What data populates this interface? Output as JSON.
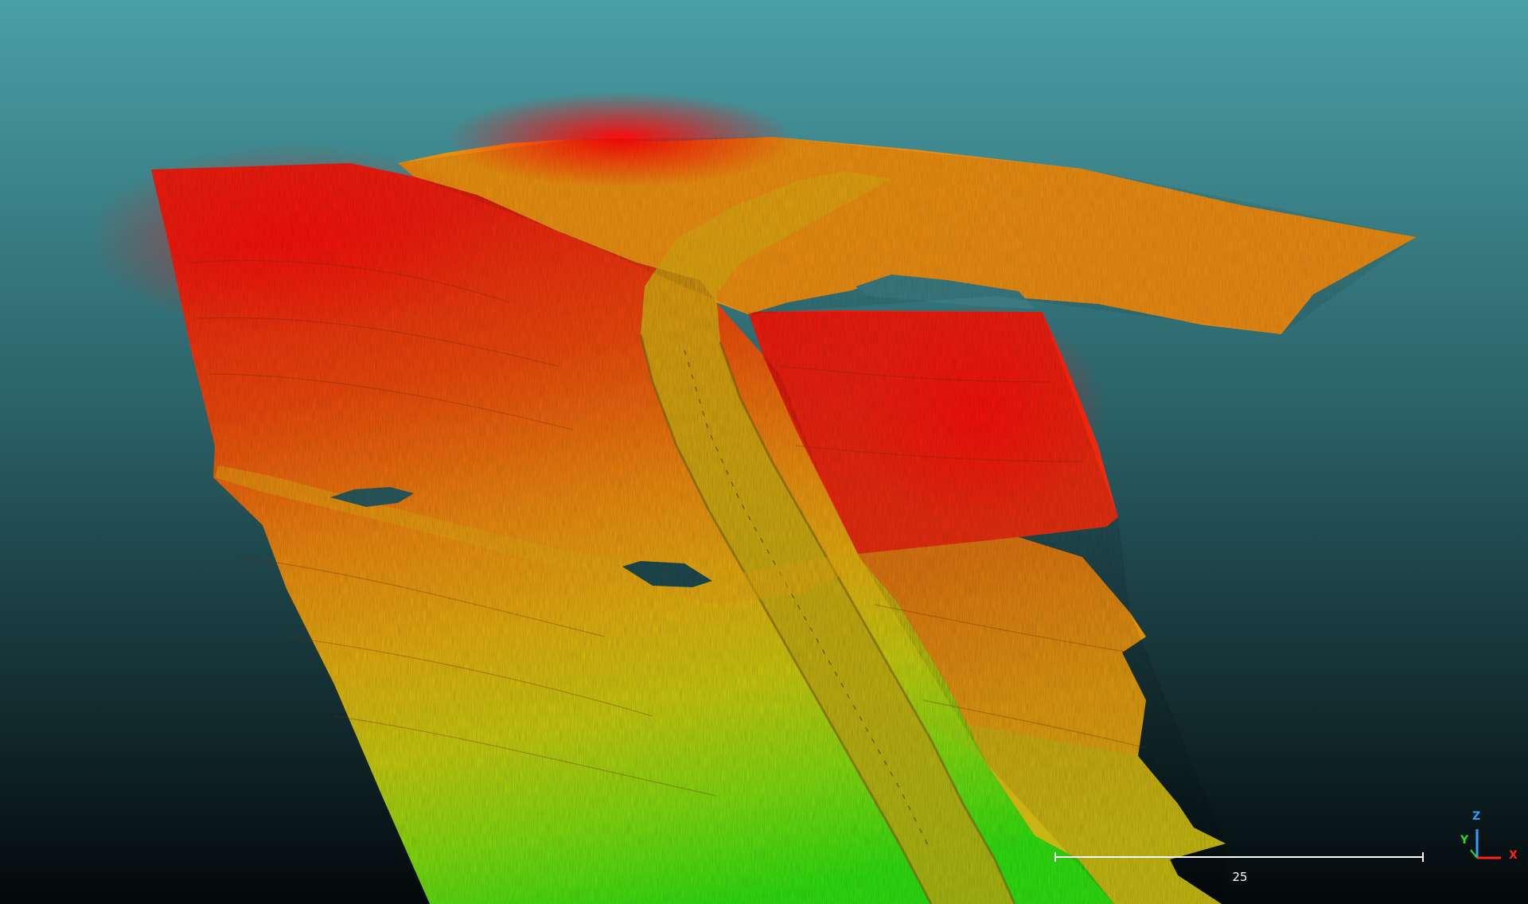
{
  "viewer": {
    "background_top": "#4a9fa6",
    "background_bottom": "#050a0c",
    "colormap": [
      "#ff0000",
      "#ff7a00",
      "#e0a800",
      "#b8d800",
      "#30e000"
    ]
  },
  "scale_bar": {
    "label": "25"
  },
  "axes": {
    "x_label": "X",
    "y_label": "Y",
    "z_label": "Z",
    "x_color": "#ff2020",
    "y_color": "#22e022",
    "z_color": "#30a0ff"
  }
}
